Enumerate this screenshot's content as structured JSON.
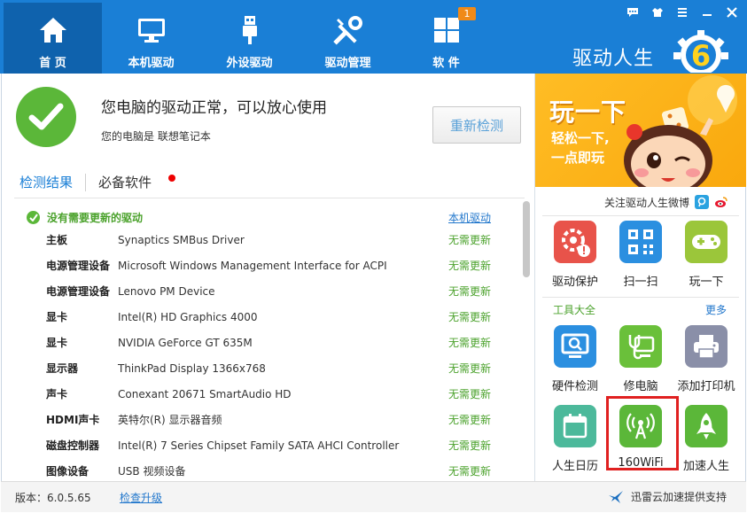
{
  "header": {
    "nav": [
      {
        "label": "首 页",
        "icon": "home-icon"
      },
      {
        "label": "本机驱动",
        "icon": "monitor-icon"
      },
      {
        "label": "外设驱动",
        "icon": "usb-icon"
      },
      {
        "label": "驱动管理",
        "icon": "tools-icon"
      },
      {
        "label": "软 件",
        "icon": "apps-grid-icon",
        "badge": "1"
      }
    ],
    "brand": "驱动人生",
    "logo_digit": "6"
  },
  "status": {
    "title": "您电脑的驱动正常，可以放心使用",
    "subtitle": "您的电脑是 联想笔记本",
    "rescan_button": "重新检测"
  },
  "tabs": {
    "results": "检测结果",
    "software": "必备软件"
  },
  "list": {
    "head_title": "没有需要更新的驱动",
    "head_link": "本机驱动",
    "rows": [
      {
        "cat": "主板",
        "dev": "Synaptics SMBus Driver",
        "status": "无需更新"
      },
      {
        "cat": "电源管理设备",
        "dev": "Microsoft Windows Management Interface for ACPI",
        "status": "无需更新"
      },
      {
        "cat": "电源管理设备",
        "dev": "Lenovo PM Device",
        "status": "无需更新"
      },
      {
        "cat": "显卡",
        "dev": "Intel(R) HD Graphics 4000",
        "status": "无需更新"
      },
      {
        "cat": "显卡",
        "dev": "NVIDIA GeForce GT 635M",
        "status": "无需更新"
      },
      {
        "cat": "显示器",
        "dev": "ThinkPad Display 1366x768",
        "status": "无需更新"
      },
      {
        "cat": "声卡",
        "dev": "Conexant 20671 SmartAudio HD",
        "status": "无需更新"
      },
      {
        "cat": "HDMI声卡",
        "dev": "英特尔(R) 显示器音频",
        "status": "无需更新"
      },
      {
        "cat": "磁盘控制器",
        "dev": "Intel(R) 7 Series Chipset Family SATA AHCI Controller",
        "status": "无需更新"
      },
      {
        "cat": "图像设备",
        "dev": "USB 视频设备",
        "status": "无需更新"
      }
    ]
  },
  "footer": {
    "version": "版本：6.0.5.65",
    "upgrade": "检查升级",
    "support": "迅雷云加速提供支持"
  },
  "side": {
    "banner_big": "玩一下",
    "banner_line1": "轻松一下,",
    "banner_line2": "一点即玩",
    "weibo": "关注驱动人生微博",
    "top_tiles": [
      {
        "label": "驱动保护",
        "color": "#e8534a"
      },
      {
        "label": "扫一扫",
        "color": "#2b8fe0"
      },
      {
        "label": "玩一下",
        "color": "#9bc63a"
      }
    ],
    "tools_head": "工具大全",
    "tools_more": "更多",
    "tools": [
      {
        "label": "硬件检测",
        "color": "#2b8fe0"
      },
      {
        "label": "修电脑",
        "color": "#6ac03a"
      },
      {
        "label": "添加打印机",
        "color": "#8a8fa8"
      },
      {
        "label": "人生日历",
        "color": "#4cb99b"
      },
      {
        "label": "160WiFi",
        "color": "#5bb739"
      },
      {
        "label": "加速人生",
        "color": "#5bb739"
      }
    ]
  },
  "colors": {
    "header_blue": "#1a7fd6",
    "active_nav": "#0f62ad",
    "ok_green": "#5bb739",
    "link_blue": "#2277cc",
    "highlight_red": "#e02020"
  }
}
